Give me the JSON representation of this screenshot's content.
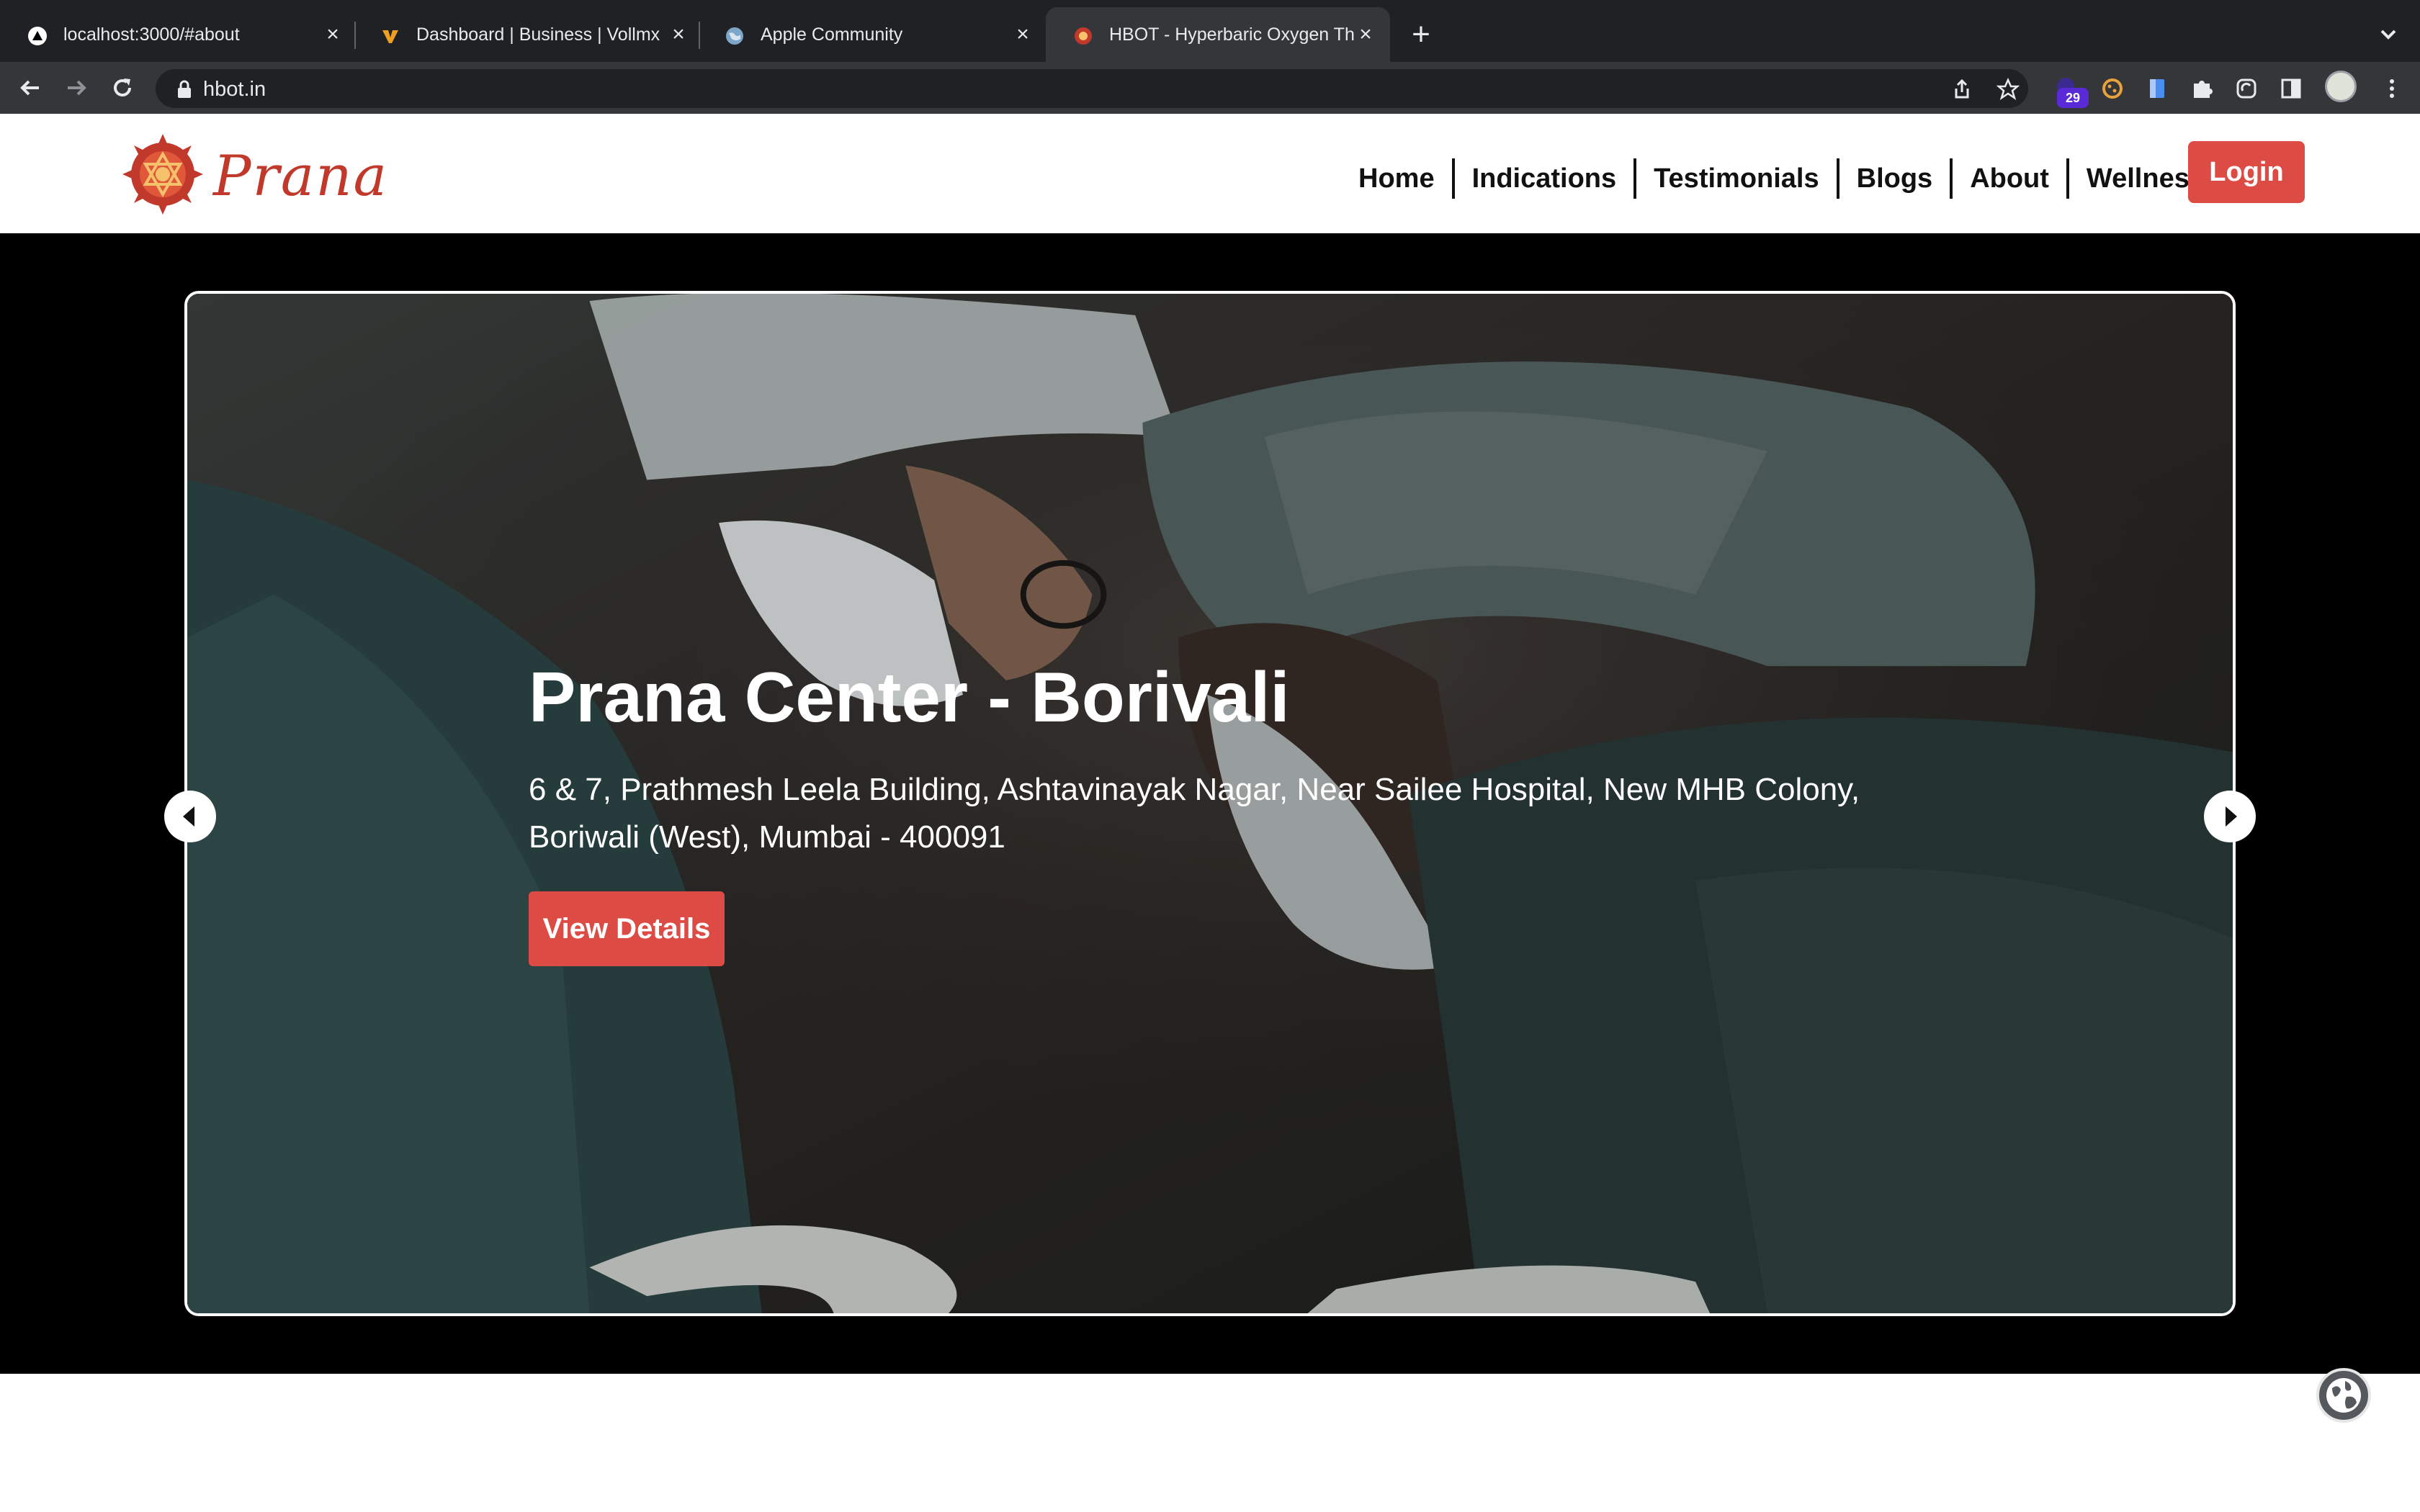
{
  "browser": {
    "tabs": [
      {
        "title": "localhost:3000/#about",
        "favicon": "triangle-icon"
      },
      {
        "title": "Dashboard | Business | Vollmx",
        "favicon": "v-logo-icon"
      },
      {
        "title": "Apple Community",
        "favicon": "globe-icon"
      },
      {
        "title": "HBOT - Hyperbaric Oxygen Th",
        "favicon": "prana-logo-icon",
        "active": true
      }
    ],
    "url": "hbot.in",
    "extension_badge": "29"
  },
  "site": {
    "brand": "Prana",
    "brand_color": "#c0392b",
    "accent_color": "#dd4b45",
    "nav": [
      "Home",
      "Indications",
      "Testimonials",
      "Blogs",
      "About",
      "Wellness"
    ],
    "login_label": "Login"
  },
  "hero": {
    "title": "Prana Center - Borivali",
    "address": "6 & 7, Prathmesh Leela Building, Ashtavinayak Nagar, Near Sailee Hospital, New MHB Colony, Boriwali (West), Mumbai - 400091",
    "cta_label": "View Details"
  }
}
